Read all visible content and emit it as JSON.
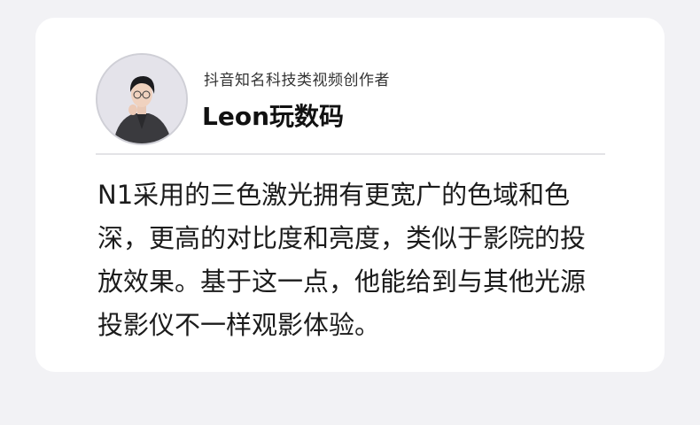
{
  "author": {
    "subtitle": "抖音知名科技类视频创作者",
    "name": "Leon玩数码"
  },
  "quote": {
    "lines": [
      "N1采用的三色激光拥有更宽广的色域和色",
      "深，更高的对比度和亮度，类似于影院的投",
      "放效果。基于这一点，他能给到与其他光源",
      "投影仪不一样观影体验。"
    ]
  }
}
